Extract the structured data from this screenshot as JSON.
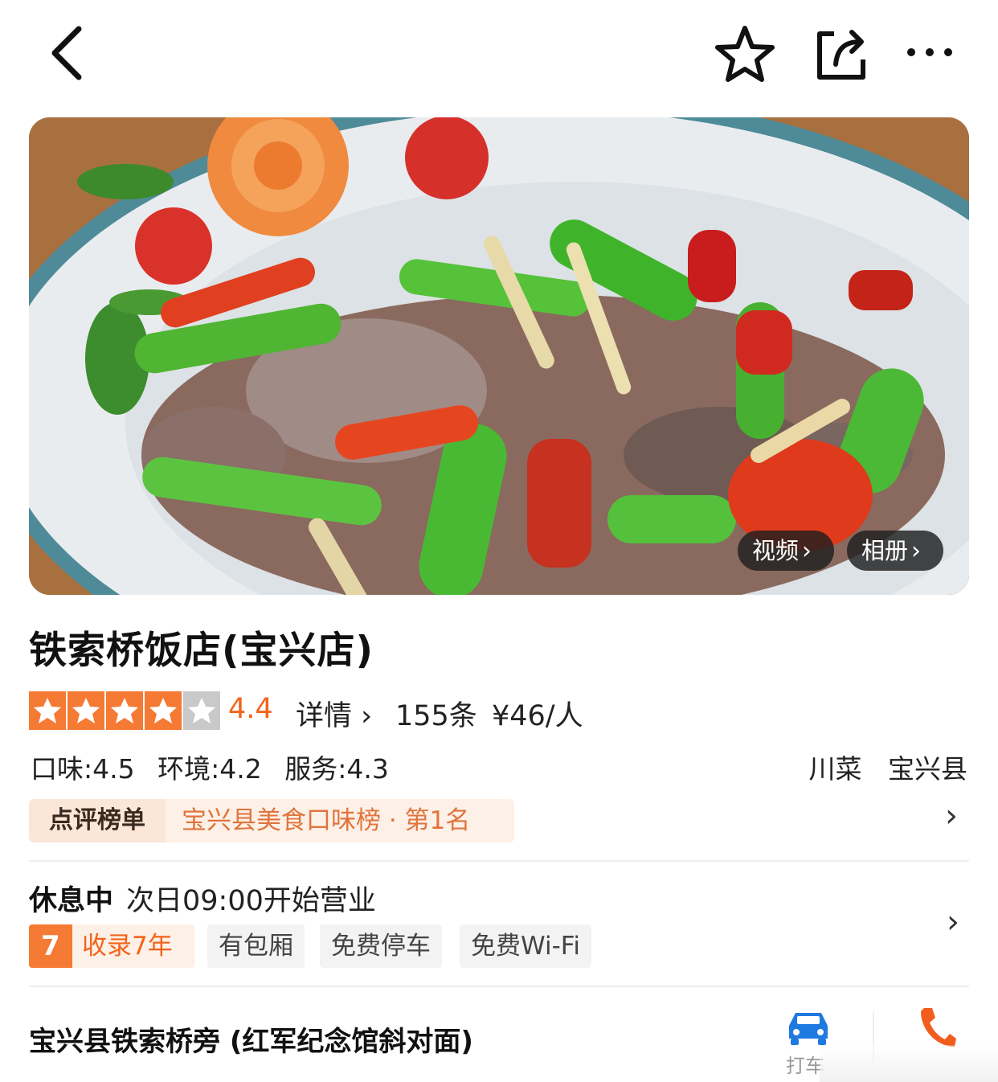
{
  "nav": {
    "back_icon": "chevron-left-icon",
    "favorite_icon": "star-outline-icon",
    "share_icon": "share-icon",
    "more_icon": "more-horizontal-icon"
  },
  "hero": {
    "video_label": "视频",
    "album_label": "相册"
  },
  "shop": {
    "title": "铁索桥饭店(宝兴店)",
    "rating": "4.4",
    "rating_value": 4.4,
    "rating_max": 5,
    "detail_label": "详情",
    "review_count": "155条",
    "price_per_person": "¥46/人",
    "scores": {
      "taste": "口味:4.5",
      "environment": "环境:4.2",
      "service": "服务:4.3"
    },
    "cuisine": "川菜",
    "region": "宝兴县"
  },
  "ranking": {
    "badge": "点评榜单",
    "text": "宝兴县美食口味榜 · 第1名"
  },
  "hours": {
    "status": "休息中",
    "next_open": "次日09:00开始营业"
  },
  "features": {
    "years_number": "7",
    "years_label": "收录7年",
    "tags": [
      "有包厢",
      "免费停车",
      "免费Wi-Fi"
    ]
  },
  "location": {
    "address": "宝兴县铁索桥旁 (红军纪念馆斜对面)",
    "taxi_label": "打车"
  },
  "colors": {
    "accent_orange": "#f2641b",
    "star_orange": "#f57a34",
    "star_gray": "#c9c9c9",
    "taxi_blue": "#1f7ae0",
    "phone_orange": "#f25c1c"
  }
}
